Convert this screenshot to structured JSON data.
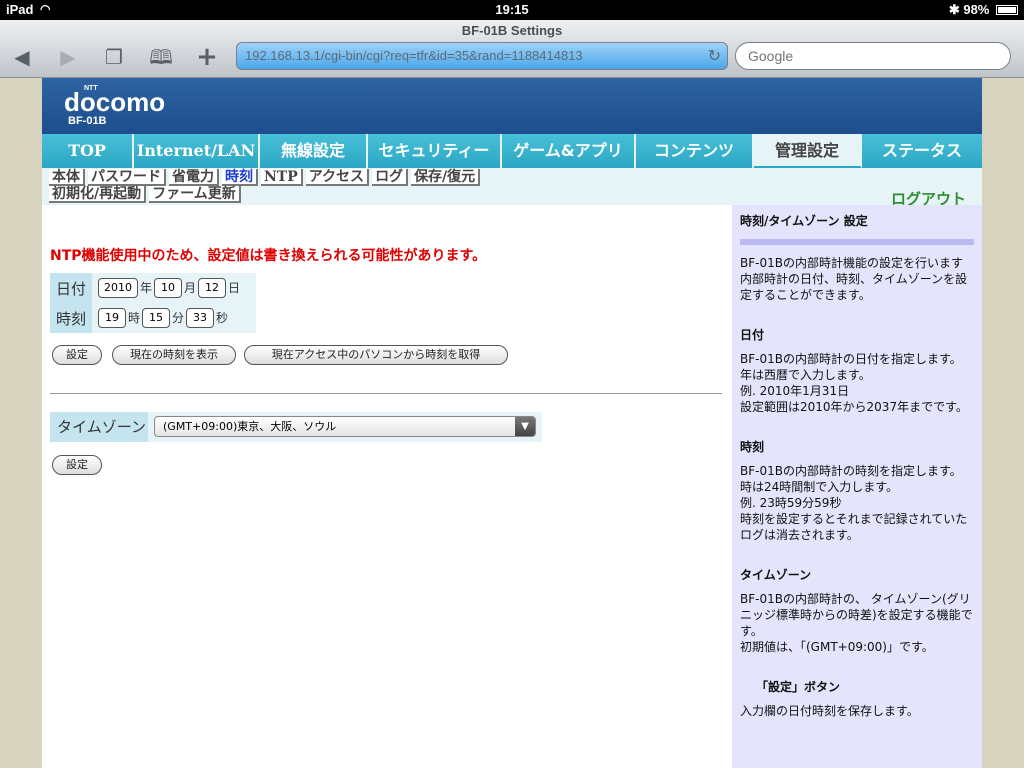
{
  "status_bar": {
    "device": "iPad",
    "time": "19:15",
    "battery": "98%"
  },
  "browser": {
    "title": "BF-01B Settings",
    "url": "192.168.13.1/cgi-bin/cgi?req=tfr&id=35&rand=1188414813",
    "search_placeholder": "Google"
  },
  "logo": {
    "ntt": "NTT",
    "brand": "docomo",
    "model": "BF-01B"
  },
  "main_tabs": [
    "TOP",
    "Internet/LAN",
    "無線設定",
    "セキュリティー",
    "ゲーム&アプリ",
    "コンテンツ",
    "管理設定",
    "ステータス"
  ],
  "sub_tabs_row1": [
    "本体",
    "パスワード",
    "省電力",
    "時刻",
    "NTP",
    "アクセス",
    "ログ",
    "保存/復元"
  ],
  "sub_tabs_row2": [
    "初期化/再起動",
    "ファーム更新"
  ],
  "logout": "ログアウト",
  "form": {
    "warning": "NTP機能使用中のため、設定値は書き換えられる可能性があります。",
    "date_label": "日付",
    "year": "2010",
    "year_unit": "年",
    "month": "10",
    "month_unit": "月",
    "day": "12",
    "day_unit": "日",
    "time_label": "時刻",
    "hour": "19",
    "hour_unit": "時",
    "minute": "15",
    "minute_unit": "分",
    "second": "33",
    "second_unit": "秒",
    "set_button": "設定",
    "show_time_button": "現在の時刻を表示",
    "get_pc_time_button": "現在アクセス中のパソコンから時刻を取得",
    "timezone_label": "タイムゾーン",
    "timezone_value": "(GMT+09:00)東京、大阪、ソウル",
    "set_button2": "設定"
  },
  "help": {
    "title": "時刻/タイムゾーン 設定",
    "intro": "BF-01Bの内部時計機能の設定を行います\n内部時計の日付、時刻、タイムゾーンを設定することができます。",
    "date_heading": "日付",
    "date_text": "BF-01Bの内部時計の日付を指定します。\n年は西暦で入力します。\n例. 2010年1月31日\n設定範囲は2010年から2037年までです。",
    "time_heading": "時刻",
    "time_text": "BF-01Bの内部時計の時刻を指定します。\n時は24時間制で入力します。\n例. 23時59分59秒\n時刻を設定するとそれまで記録されていたログは消去されます。",
    "tz_heading": "タイムゾーン",
    "tz_text": "BF-01Bの内部時計の、 タイムゾーン(グリニッジ標準時からの時差)を設定する機能です。\n初期値は、「(GMT+09:00)」です。",
    "set_heading": "「設定」ボタン",
    "set_text": "入力欄の日付時刻を保存します。"
  }
}
